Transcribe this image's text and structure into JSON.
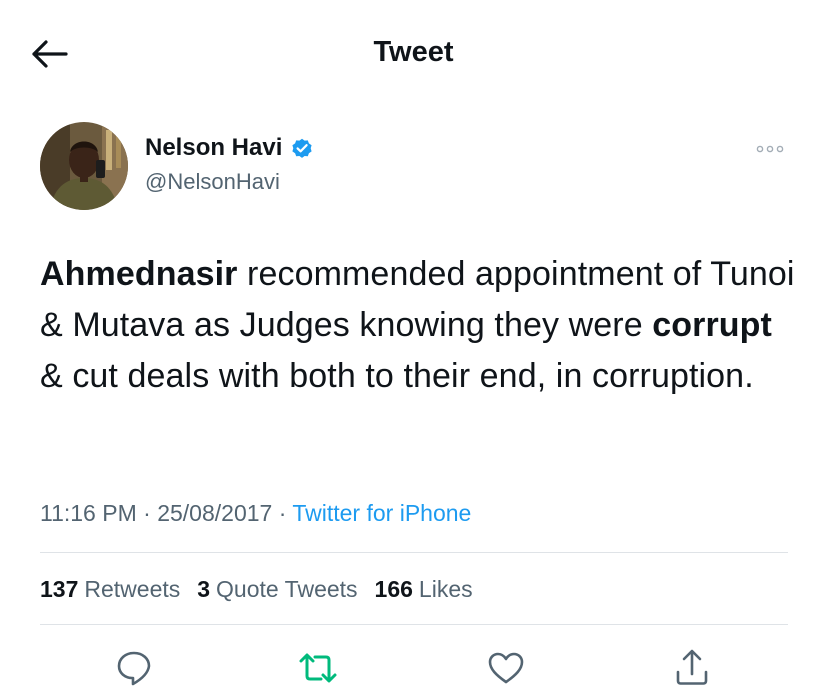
{
  "header": {
    "title": "Tweet",
    "back_icon": "arrow-left-icon"
  },
  "author": {
    "display_name": "Nelson Havi",
    "handle": "@NelsonHavi",
    "verified": true,
    "verified_color": "#1d9bf0"
  },
  "tweet": {
    "text": {
      "seg1": "Ahmednasir",
      "seg2": " recommended appointment of Tunoi & Mutava as Judges knowing they were ",
      "seg3": "corrupt",
      "seg4": " & cut deals with both to their end, in corruption."
    },
    "time": "11:16 PM",
    "date": "25/08/2017",
    "source": "Twitter for iPhone"
  },
  "stats": {
    "retweets": {
      "count": "137",
      "label": "Retweets"
    },
    "quotes": {
      "count": "3",
      "label": "Quote Tweets"
    },
    "likes": {
      "count": "166",
      "label": "Likes"
    }
  },
  "actions": {
    "reply_icon": "reply-icon",
    "retweet_icon": "retweet-icon",
    "like_icon": "heart-icon",
    "share_icon": "share-icon",
    "retweet_color": "#00ba7c"
  },
  "colors": {
    "accent": "#1d9bf0",
    "secondary_text": "#536471",
    "divider": "#dfe3e7"
  }
}
